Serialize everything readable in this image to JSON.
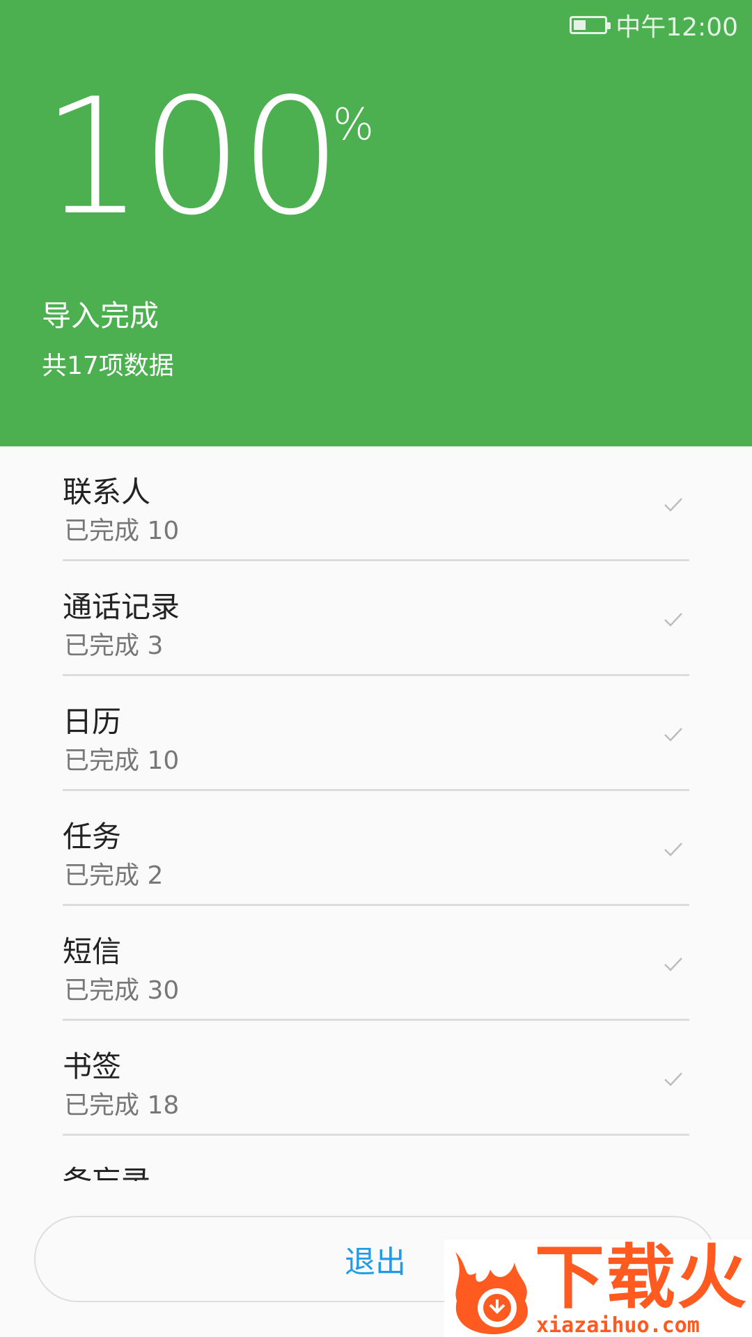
{
  "status_bar": {
    "time": "中午12:00",
    "battery_level": 0.4
  },
  "header": {
    "percent": "100",
    "percent_sign": "%",
    "title": "导入完成",
    "count_text": "共17项数据"
  },
  "items": [
    {
      "title": "联系人",
      "status": "已完成 10"
    },
    {
      "title": "通话记录",
      "status": "已完成 3"
    },
    {
      "title": "日历",
      "status": "已完成 10"
    },
    {
      "title": "任务",
      "status": "已完成 2"
    },
    {
      "title": "短信",
      "status": "已完成 30"
    },
    {
      "title": "书签",
      "status": "已完成 18"
    },
    {
      "title": "备忘录",
      "status": ""
    }
  ],
  "footer": {
    "exit_label": "退出"
  },
  "watermark": {
    "brand": "下载火",
    "url": "xiazaihuo.com"
  },
  "colors": {
    "header_bg": "#4caf50",
    "accent": "#1e9be9",
    "watermark": "#ff5a1f"
  }
}
